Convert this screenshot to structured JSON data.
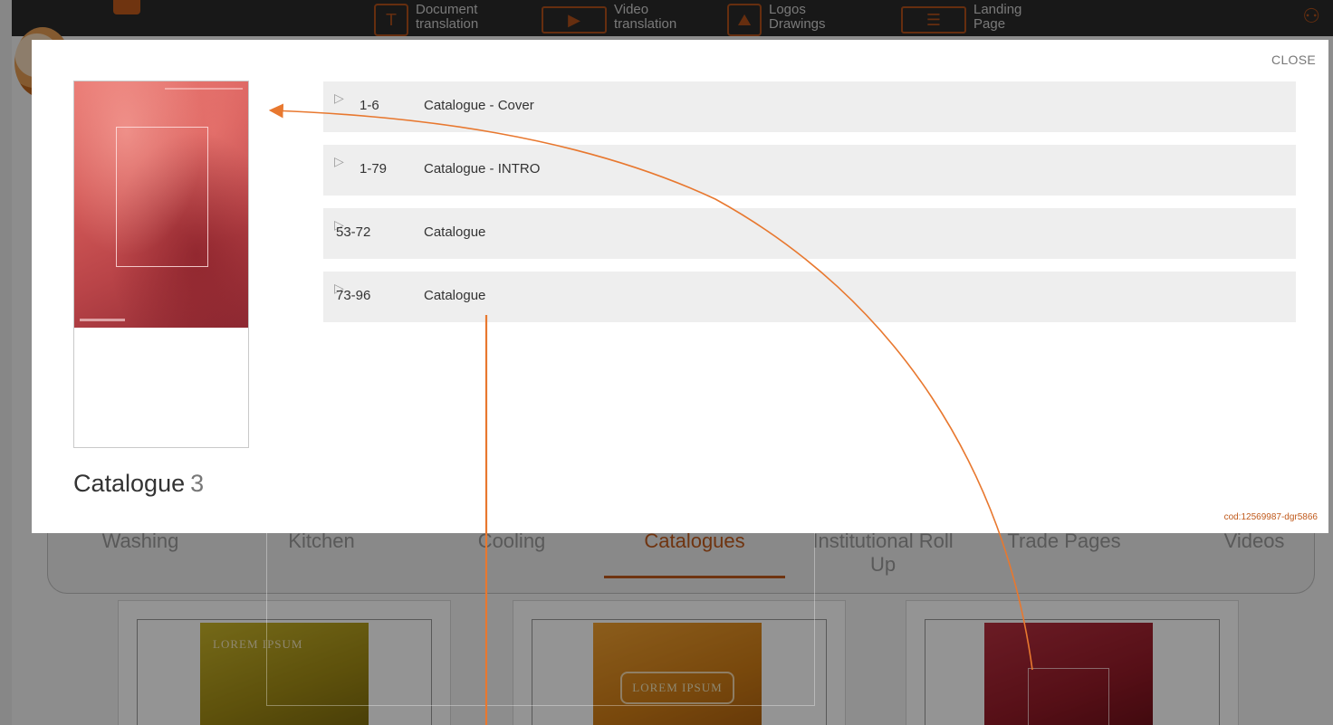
{
  "nav": {
    "items": [
      {
        "label": "Document\ntranslation",
        "icon": "document-translation-icon"
      },
      {
        "label": "Video\ntranslation",
        "icon": "video-play-icon"
      },
      {
        "label": "Logos\nDrawings",
        "icon": "logos-drawings-icon"
      },
      {
        "label": "Landing\nPage",
        "icon": "landing-page-icon"
      }
    ]
  },
  "tabs": [
    {
      "label": "Washing"
    },
    {
      "label": "Kitchen"
    },
    {
      "label": "Cooling"
    },
    {
      "label": "Catalogues",
      "active": true
    },
    {
      "label": "Institutional Roll\nUp"
    },
    {
      "label": "Trade Pages"
    },
    {
      "label": "Videos"
    }
  ],
  "cards": [
    {
      "lorem": "LOREM IPSUM",
      "color": "#b5a21e"
    },
    {
      "lorem": "LOREM IPSUM",
      "color": "#e08a1e"
    },
    {
      "lorem": "",
      "color": "#9a1f2a"
    }
  ],
  "modal": {
    "close_label": "CLOSE",
    "title": "Catalogue",
    "count": "3",
    "code": "cod:12569987-dgr5866",
    "rows": [
      {
        "range": "1-6",
        "name": "Catalogue   - Cover"
      },
      {
        "range": "1-79",
        "name": "Catalogue   - INTRO"
      },
      {
        "range": "53-72",
        "name": "Catalogue"
      },
      {
        "range": "73-96",
        "name": "Catalogue"
      }
    ]
  },
  "colors": {
    "accent": "#c05a1c",
    "annotation": "#e8782f",
    "row_bg": "#eeeeee"
  }
}
